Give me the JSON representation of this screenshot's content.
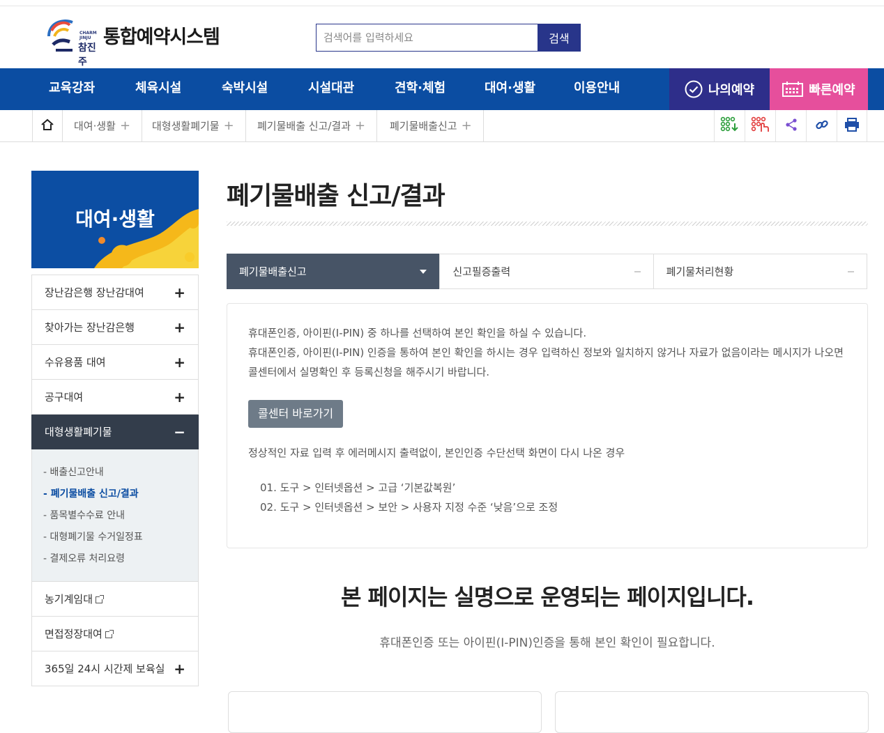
{
  "header": {
    "logo_text": "통합예약시스템",
    "logo_sub_en": "CHARM JINJU",
    "logo_sub_kr": "참진주",
    "search_placeholder": "검색어를 입력하세요",
    "search_button": "검색"
  },
  "gnb": {
    "items": [
      "교육강좌",
      "체육시설",
      "숙박시설",
      "시설대관",
      "견학·체험",
      "대여·생활",
      "이용안내"
    ],
    "my_reservation": "나의예약",
    "quick_reservation": "빠른예약"
  },
  "breadcrumb": {
    "items": [
      "대여·생활",
      "대형생활폐기물",
      "폐기물배출 신고/결과",
      "폐기물배출신고"
    ]
  },
  "lnb": {
    "title": "대여·생활",
    "items": [
      {
        "label": "장난감은행 장난감대여",
        "sign": "+"
      },
      {
        "label": "찾아가는 장난감은행",
        "sign": "+"
      },
      {
        "label": "수유용품 대여",
        "sign": "+"
      },
      {
        "label": "공구대여",
        "sign": "+"
      },
      {
        "label": "대형생활폐기물",
        "sign": "−"
      }
    ],
    "sub_items": [
      "배출신고안내",
      "폐기물배출 신고/결과",
      "품목별수수료 안내",
      "대형폐기물 수거일정표",
      "결제오류 처리요령"
    ],
    "more_items": [
      {
        "label": "농기계임대"
      },
      {
        "label": "면접정장대여"
      },
      {
        "label": "365일 24시 시간제 보육실",
        "sign": "+"
      }
    ]
  },
  "content": {
    "title": "폐기물배출 신고/결과",
    "tabs": [
      "폐기물배출신고",
      "신고필증출력",
      "폐기물처리현황"
    ],
    "info_line1": "휴대폰인증, 아이핀(I-PIN) 중 하나를 선택하여 본인 확인을 하실 수 있습니다.",
    "info_line2": "휴대폰인증, 아이핀(I-PIN) 인증을 통하여 본인 확인을 하시는 경우 입력하신 정보와 일치하지 않거나 자료가 없음이라는 메시지가 나오면 콜센터에서 실명확인 후 등록신청을 해주시기 바랍니다.",
    "call_button": "콜센터 바로가기",
    "note": "정상적인 자료 입력 후 에러메시지 출력없이, 본인인증 수단선택 화면이 다시 나온 경우",
    "steps": [
      "01. 도구 > 인터넷옵션 > 고급 ‘기본값복원’",
      "02. 도구 > 인터넷옵션 > 보안 > 사용자 지정 수준 ‘낮음’으로 조정"
    ],
    "realname_title": "본 페이지는 실명으로 운영되는 페이지입니다.",
    "realname_sub": "휴대폰인증 또는 아이핀(I-PIN)인증을 통해 본인 확인이 필요합니다."
  },
  "colors": {
    "gnb": "#0b4da2",
    "my_reservation": "#2e2e8a",
    "quick_reservation": "#e64f9c",
    "active_tab": "#475466",
    "lnb_active": "#333d4b"
  }
}
